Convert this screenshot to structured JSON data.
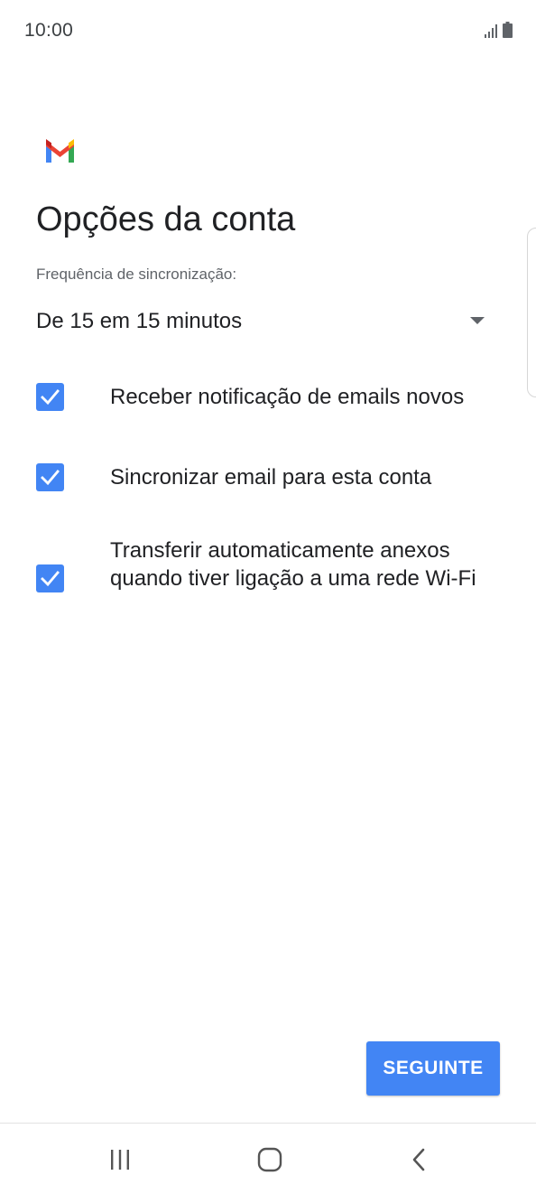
{
  "status_bar": {
    "time": "10:00",
    "icons": [
      "signal-icon",
      "battery-icon"
    ]
  },
  "app": {
    "logo_icon": "gmail-logo-icon",
    "brand_colors": {
      "red": "#EA4335",
      "blue": "#4285F4",
      "green": "#34A853",
      "yellow": "#FBBC04"
    }
  },
  "page": {
    "title": "Opções da conta",
    "sync_label": "Frequência de sincronização:",
    "sync_frequency": {
      "selected": "De 15 em 15 minutos",
      "icon": "dropdown-arrow-icon"
    },
    "options": [
      {
        "label": "Receber notificação de emails novos",
        "checked": true
      },
      {
        "label": "Sincronizar email para esta conta",
        "checked": true
      },
      {
        "label": "Transferir automaticamente anexos quando tiver ligação a uma rede Wi-Fi",
        "checked": true
      }
    ],
    "next_button": "SEGUINTE",
    "accent_color": "#4285F4"
  },
  "nav_bar": {
    "buttons": [
      "recent-apps-icon",
      "home-icon",
      "back-icon"
    ]
  }
}
